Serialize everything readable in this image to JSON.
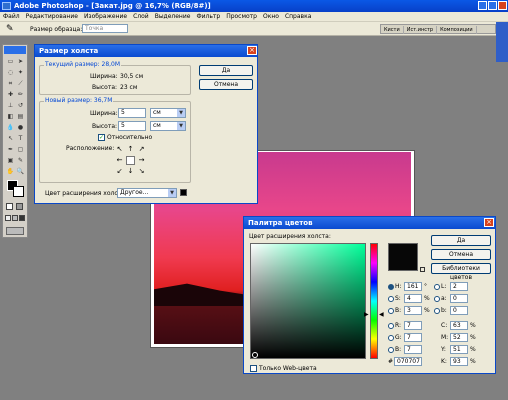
{
  "app": {
    "title": "Adobe Photoshop - [Закат.jpg @ 16,7% (RGB/8#)]",
    "menu": [
      "Файл",
      "Редактирование",
      "Изображение",
      "Слой",
      "Выделение",
      "Фильтр",
      "Просмотр",
      "Окно",
      "Справка"
    ]
  },
  "options_bar": {
    "sample_label": "Размер образца:",
    "sample_value": "Точка"
  },
  "palette_tabs": [
    "Кисти",
    "Ист.инстр",
    "Композиции"
  ],
  "canvas_dialog": {
    "title": "Размер холста",
    "ok": "Да",
    "cancel": "Отмена",
    "current_legend": "Текущий размер: 28,0M",
    "width_label": "Ширина:",
    "width_value": "30,5 см",
    "height_label": "Высота:",
    "height_value": "23 см",
    "new_legend": "Новый размер: 36,7M",
    "new_width_label": "Ширина:",
    "new_width_value": "5",
    "new_width_unit": "см",
    "new_height_label": "Высота:",
    "new_height_value": "5",
    "new_height_unit": "см",
    "relative_label": "Относительно",
    "relative_checked": true,
    "anchor_label": "Расположение:",
    "ext_label": "Цвет расширения холста:",
    "ext_value": "Другое..."
  },
  "color_picker": {
    "title": "Палитра цветов",
    "subtitle": "Цвет расширения холста:",
    "ok": "Да",
    "cancel": "Отмена",
    "libraries": "Библиотеки цветов",
    "H": "161",
    "H_unit": "°",
    "S": "4",
    "S_unit": "%",
    "B": "3",
    "B_unit": "%",
    "R": "7",
    "G": "7",
    "Bv": "7",
    "L": "2",
    "a": "0",
    "b": "0",
    "C": "63",
    "M": "52",
    "Y": "51",
    "K": "93",
    "hex_label": "#",
    "hex": "070707",
    "web_only": "Только Web-цвета",
    "current_color": "#070707",
    "base_hue": "#00ff99"
  }
}
